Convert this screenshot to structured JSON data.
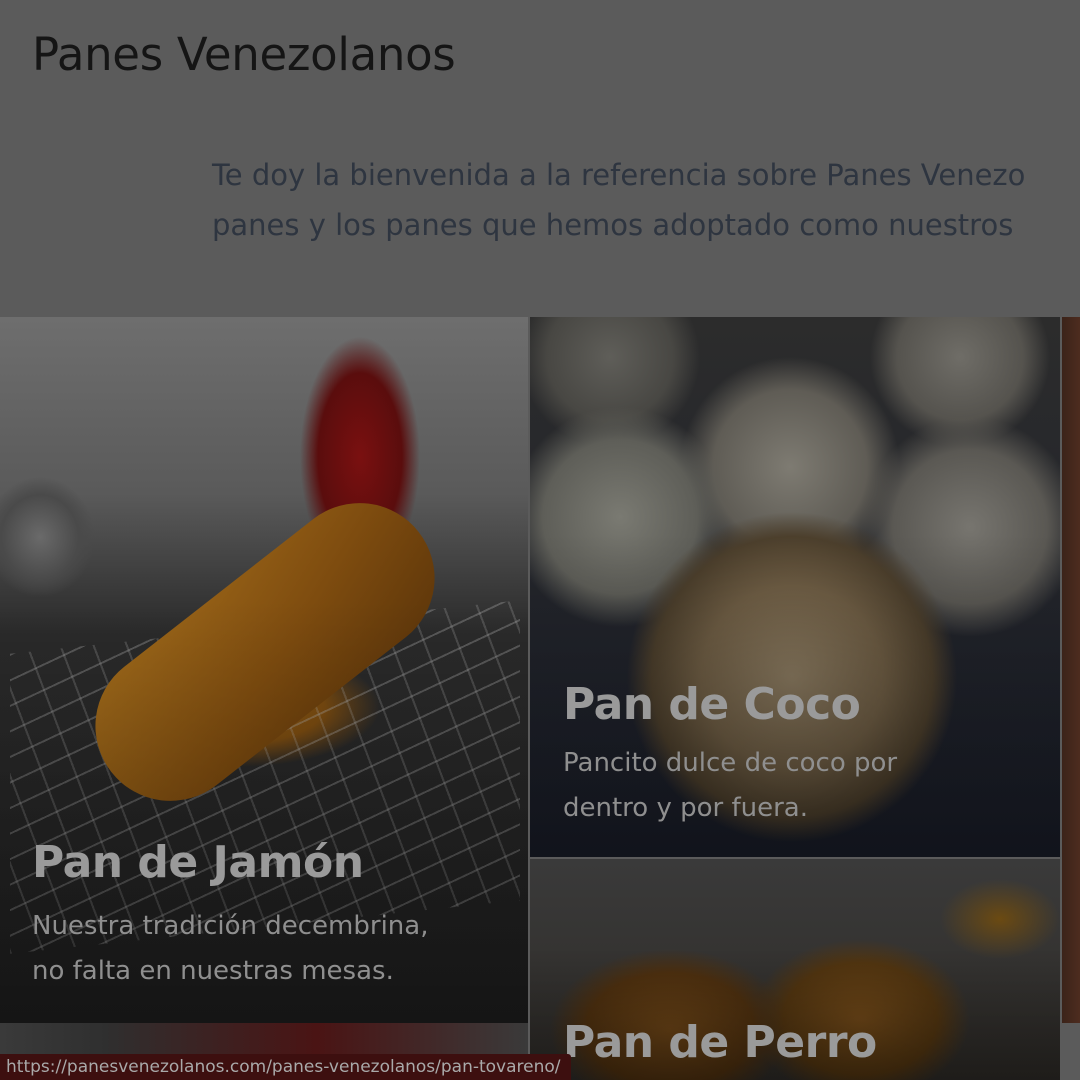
{
  "site": {
    "title": "Panes Venezolanos"
  },
  "intro": {
    "line1": "Te doy la bienvenida a la referencia sobre Panes Venezo",
    "line2": "panes y los panes que hemos adoptado como nuestros"
  },
  "tiles": [
    {
      "title": "Pan de Jamón",
      "description": "Nuestra tradición decembrina, no falta en nuestras mesas.",
      "desc_line1": "Nuestra tradición decembrina,",
      "desc_line2": "no falta en nuestras mesas."
    },
    {
      "title": "Pan de Coco",
      "description": "Pancito dulce de coco por dentro y por fuera.",
      "desc_line1": "Pancito dulce de coco por",
      "desc_line2": "dentro y por fuera."
    },
    {
      "title": "Pan de Perro"
    }
  ],
  "status_bar": {
    "url": "https://panesvenezolanos.com/panes-venezolanos/pan-tovareno/"
  }
}
